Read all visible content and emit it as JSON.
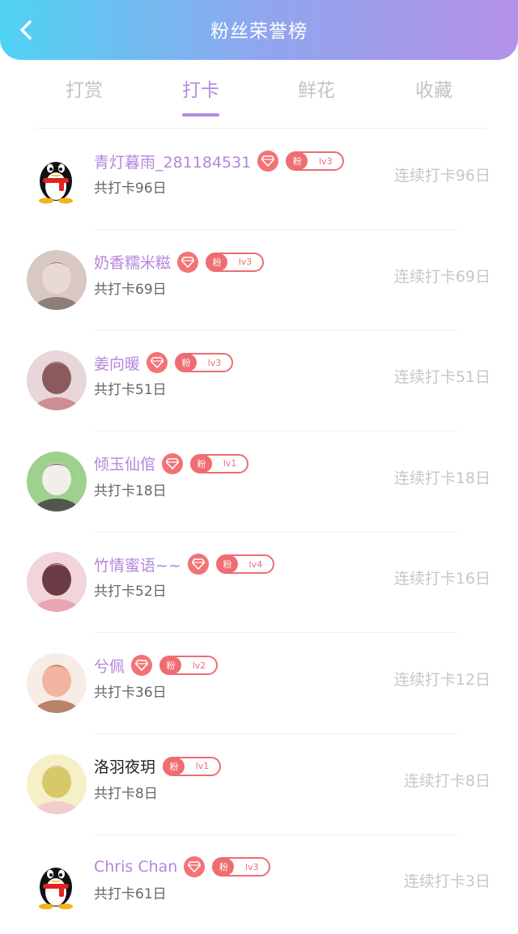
{
  "header": {
    "title": "粉丝荣誉榜",
    "background_gradient": [
      "#4fd3f4",
      "#8fa6ee",
      "#b592ea"
    ]
  },
  "tabs": [
    {
      "label": "打赏",
      "active": false
    },
    {
      "label": "打卡",
      "active": true
    },
    {
      "label": "鲜花",
      "active": false
    },
    {
      "label": "收藏",
      "active": false
    }
  ],
  "colors": {
    "accent": "#b48be4",
    "badge": "#ee6d72",
    "muted": "#c7c7c7"
  },
  "fans": [
    {
      "name": "青灯暮雨_281184531",
      "name_color": "purple",
      "gem": true,
      "fan_label": "粉",
      "level": "lv3",
      "total": "共打卡96日",
      "streak": "连续打卡96日",
      "avatar": "qq-penguin"
    },
    {
      "name": "奶香糯米糍",
      "name_color": "purple",
      "gem": true,
      "fan_label": "粉",
      "level": "lv3",
      "total": "共打卡69日",
      "streak": "连续打卡69日",
      "avatar": "photo"
    },
    {
      "name": "姜向暖",
      "name_color": "purple",
      "gem": true,
      "fan_label": "粉",
      "level": "lv3",
      "total": "共打卡51日",
      "streak": "连续打卡51日",
      "avatar": "photo"
    },
    {
      "name": "倾玉仙倌",
      "name_color": "purple",
      "gem": true,
      "fan_label": "粉",
      "level": "lv1",
      "total": "共打卡18日",
      "streak": "连续打卡18日",
      "avatar": "photo"
    },
    {
      "name": "竹情蜜语~~",
      "name_color": "purple",
      "gem": true,
      "fan_label": "粉",
      "level": "lv4",
      "total": "共打卡52日",
      "streak": "连续打卡16日",
      "avatar": "photo"
    },
    {
      "name": "兮佩",
      "name_color": "purple",
      "gem": true,
      "fan_label": "粉",
      "level": "lv2",
      "total": "共打卡36日",
      "streak": "连续打卡12日",
      "avatar": "cartoon"
    },
    {
      "name": "洛羽夜玥",
      "name_color": "dark",
      "gem": false,
      "fan_label": "粉",
      "level": "lv1",
      "total": "共打卡8日",
      "streak": "连续打卡8日",
      "avatar": "anime"
    },
    {
      "name": "Chris Chan",
      "name_color": "purple",
      "gem": true,
      "fan_label": "粉",
      "level": "lv3",
      "total": "共打卡61日",
      "streak": "连续打卡3日",
      "avatar": "qq-penguin"
    }
  ]
}
